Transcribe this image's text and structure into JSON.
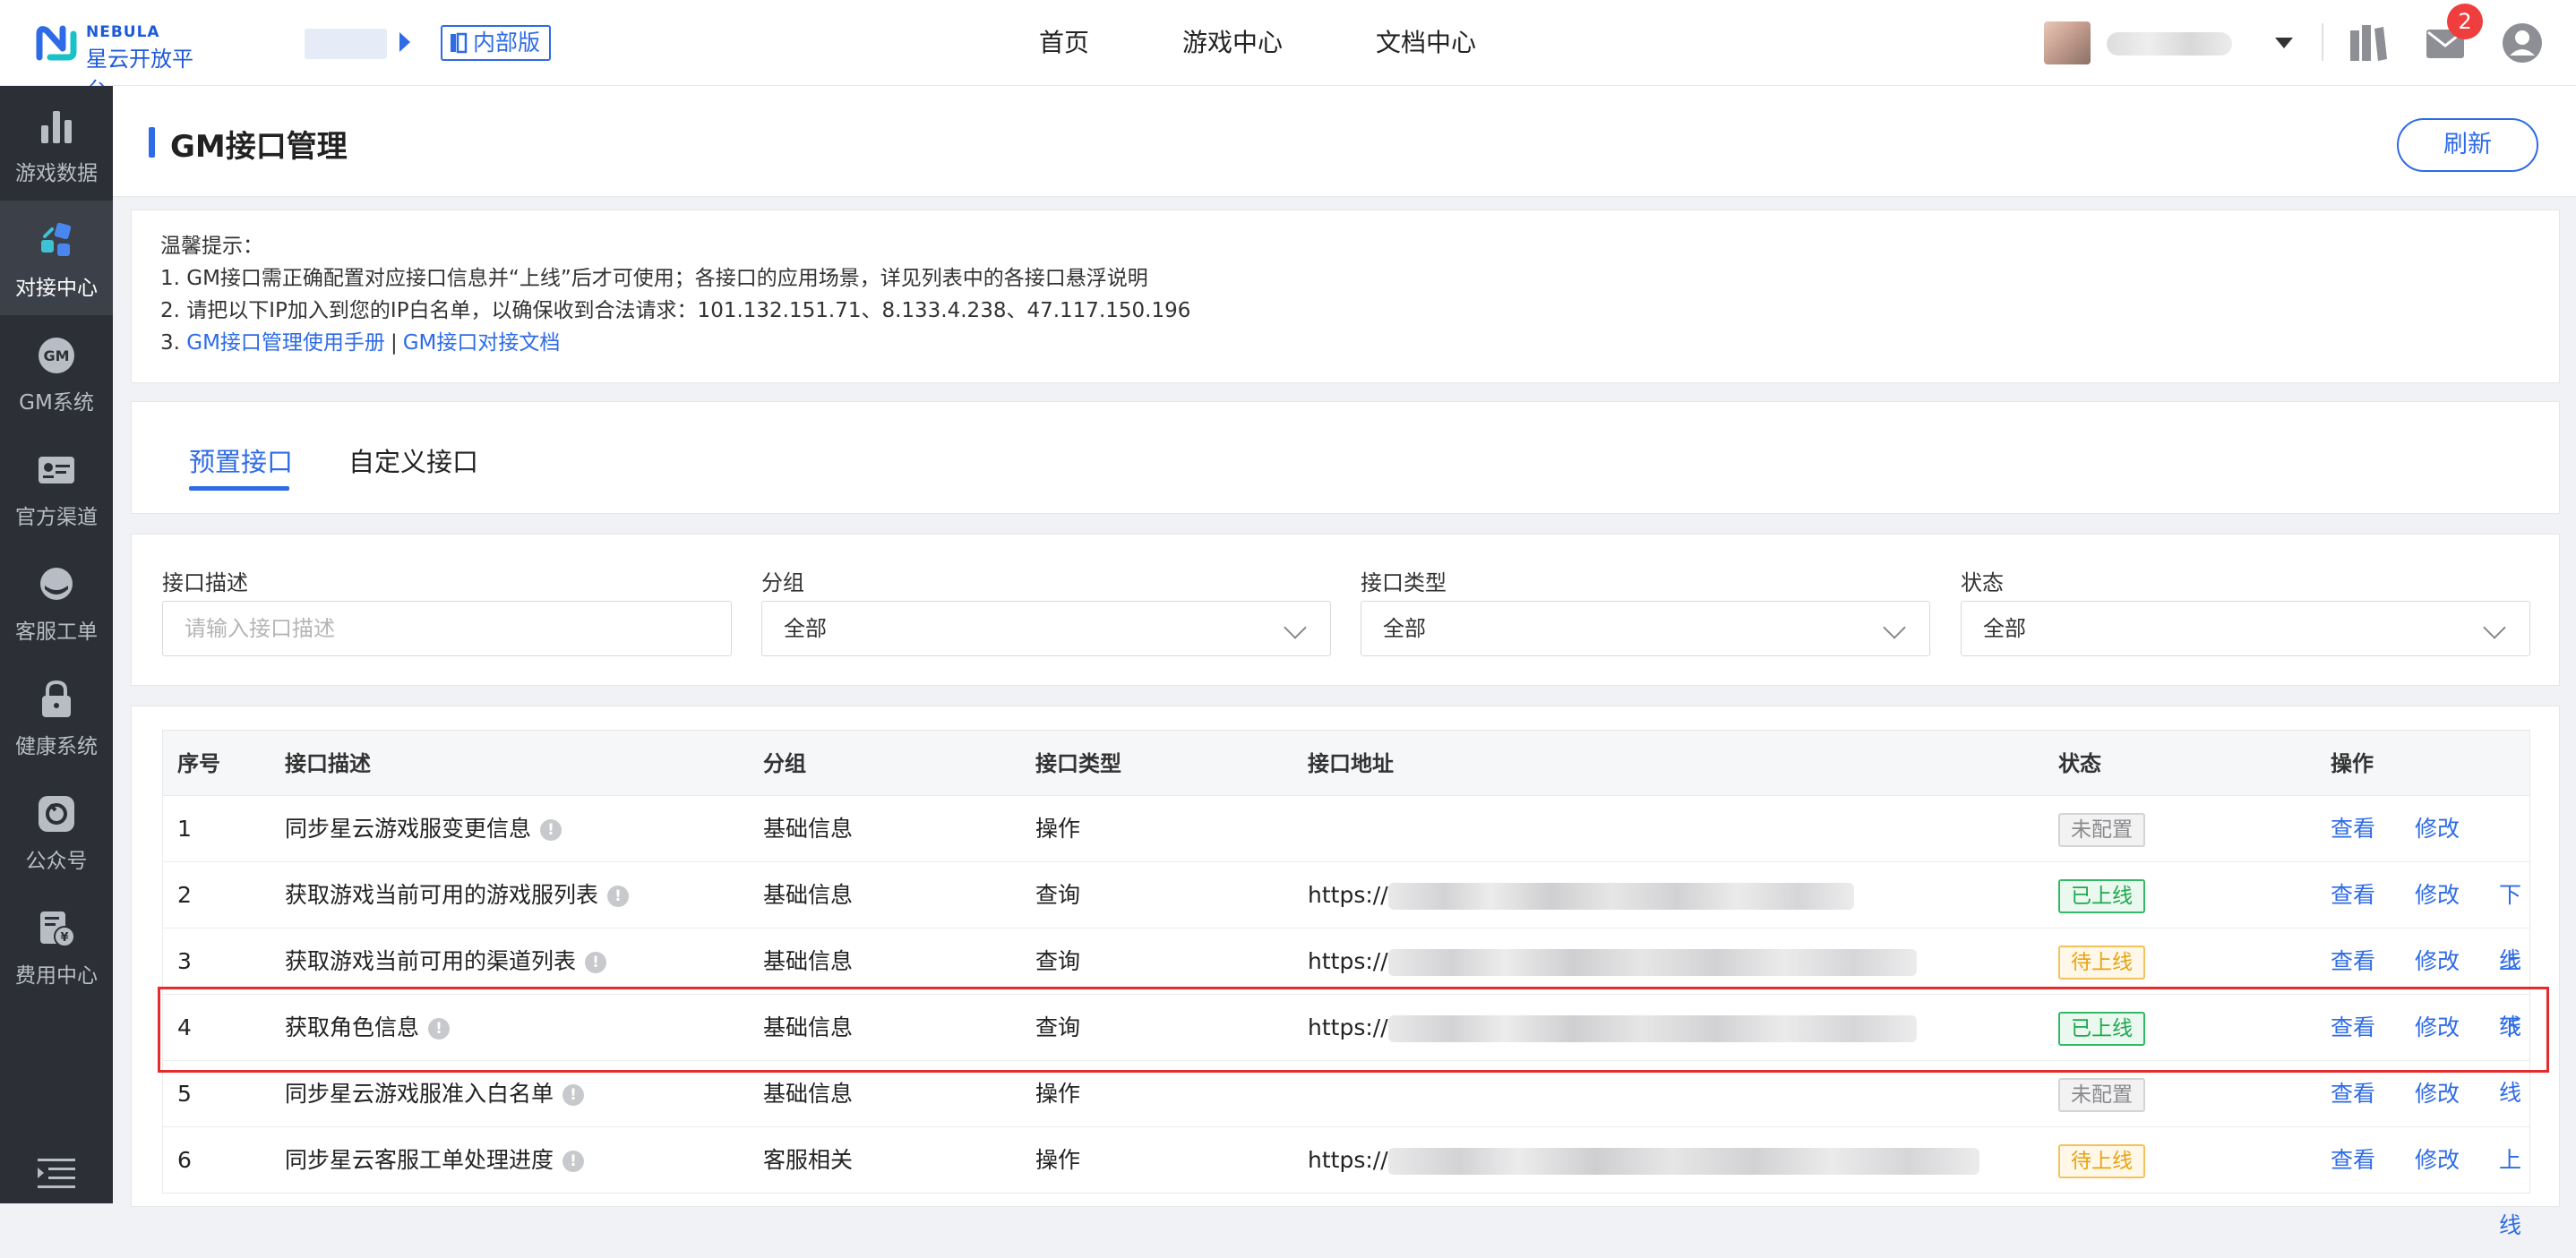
{
  "brand": {
    "name_en": "NEBULA",
    "name_cn": "星云开放平台",
    "color": "#1d5ad8"
  },
  "header": {
    "badge": "内部版",
    "nav": [
      "首页",
      "游戏中心",
      "文档中心"
    ],
    "mail_count": "2",
    "icons": [
      "book-icon",
      "mail-icon",
      "user-icon"
    ]
  },
  "sidebar": {
    "items": [
      {
        "label": "游戏数据",
        "icon": "bar-chart-icon"
      },
      {
        "label": "对接中心",
        "icon": "integration-icon",
        "active": true
      },
      {
        "label": "GM系统",
        "icon": "gm-icon"
      },
      {
        "label": "官方渠道",
        "icon": "id-card-icon"
      },
      {
        "label": "客服工单",
        "icon": "headset-icon"
      },
      {
        "label": "健康系统",
        "icon": "lock-icon"
      },
      {
        "label": "公众号",
        "icon": "public-account-icon"
      },
      {
        "label": "费用中心",
        "icon": "billing-icon"
      }
    ]
  },
  "page": {
    "title": "GM接口管理",
    "refresh": "刷新",
    "tips": {
      "heading": "温馨提示：",
      "line1": "1. GM接口需正确配置对应接口信息并“上线”后才可使用；各接口的应用场景，详见列表中的各接口悬浮说明",
      "line2": "2. 请把以下IP加入到您的IP白名单，以确保收到合法请求：101.132.151.71、8.133.4.238、47.117.150.196",
      "line3_prefix": "3. ",
      "link1": "GM接口管理使用手册",
      "sep": "|",
      "link2": "GM接口对接文档"
    },
    "tabs": [
      "预置接口",
      "自定义接口"
    ],
    "filters": {
      "desc_label": "接口描述",
      "desc_placeholder": "请输入接口描述",
      "group_label": "分组",
      "group_value": "全部",
      "type_label": "接口类型",
      "type_value": "全部",
      "status_label": "状态",
      "status_value": "全部"
    },
    "table": {
      "headers": [
        "序号",
        "接口描述",
        "分组",
        "接口类型",
        "接口地址",
        "状态",
        "操作"
      ],
      "rows": [
        {
          "no": "1",
          "desc": "同步星云游戏服变更信息",
          "group": "基础信息",
          "type": "操作",
          "url": "",
          "status": "未配置",
          "status_kind": "none",
          "ops": [
            "查看",
            "修改"
          ]
        },
        {
          "no": "2",
          "desc": "获取游戏当前可用的游戏服列表",
          "group": "基础信息",
          "type": "查询",
          "url": "https://",
          "status": "已上线",
          "status_kind": "online",
          "ops": [
            "查看",
            "修改",
            "下线"
          ]
        },
        {
          "no": "3",
          "desc": "获取游戏当前可用的渠道列表",
          "group": "基础信息",
          "type": "查询",
          "url": "https://",
          "status": "待上线",
          "status_kind": "pending",
          "ops": [
            "查看",
            "修改",
            "上线"
          ]
        },
        {
          "no": "4",
          "desc": "获取角色信息",
          "group": "基础信息",
          "type": "查询",
          "url": "https://",
          "status": "已上线",
          "status_kind": "online",
          "ops": [
            "查看",
            "修改",
            "下线"
          ]
        },
        {
          "no": "5",
          "desc": "同步星云游戏服准入白名单",
          "group": "基础信息",
          "type": "操作",
          "url": "",
          "status": "未配置",
          "status_kind": "none",
          "ops": [
            "查看",
            "修改"
          ]
        },
        {
          "no": "6",
          "desc": "同步星云客服工单处理进度",
          "group": "客服相关",
          "type": "操作",
          "url": "https://",
          "status": "待上线",
          "status_kind": "pending",
          "ops": [
            "查看",
            "修改",
            "上线"
          ]
        }
      ]
    }
  }
}
